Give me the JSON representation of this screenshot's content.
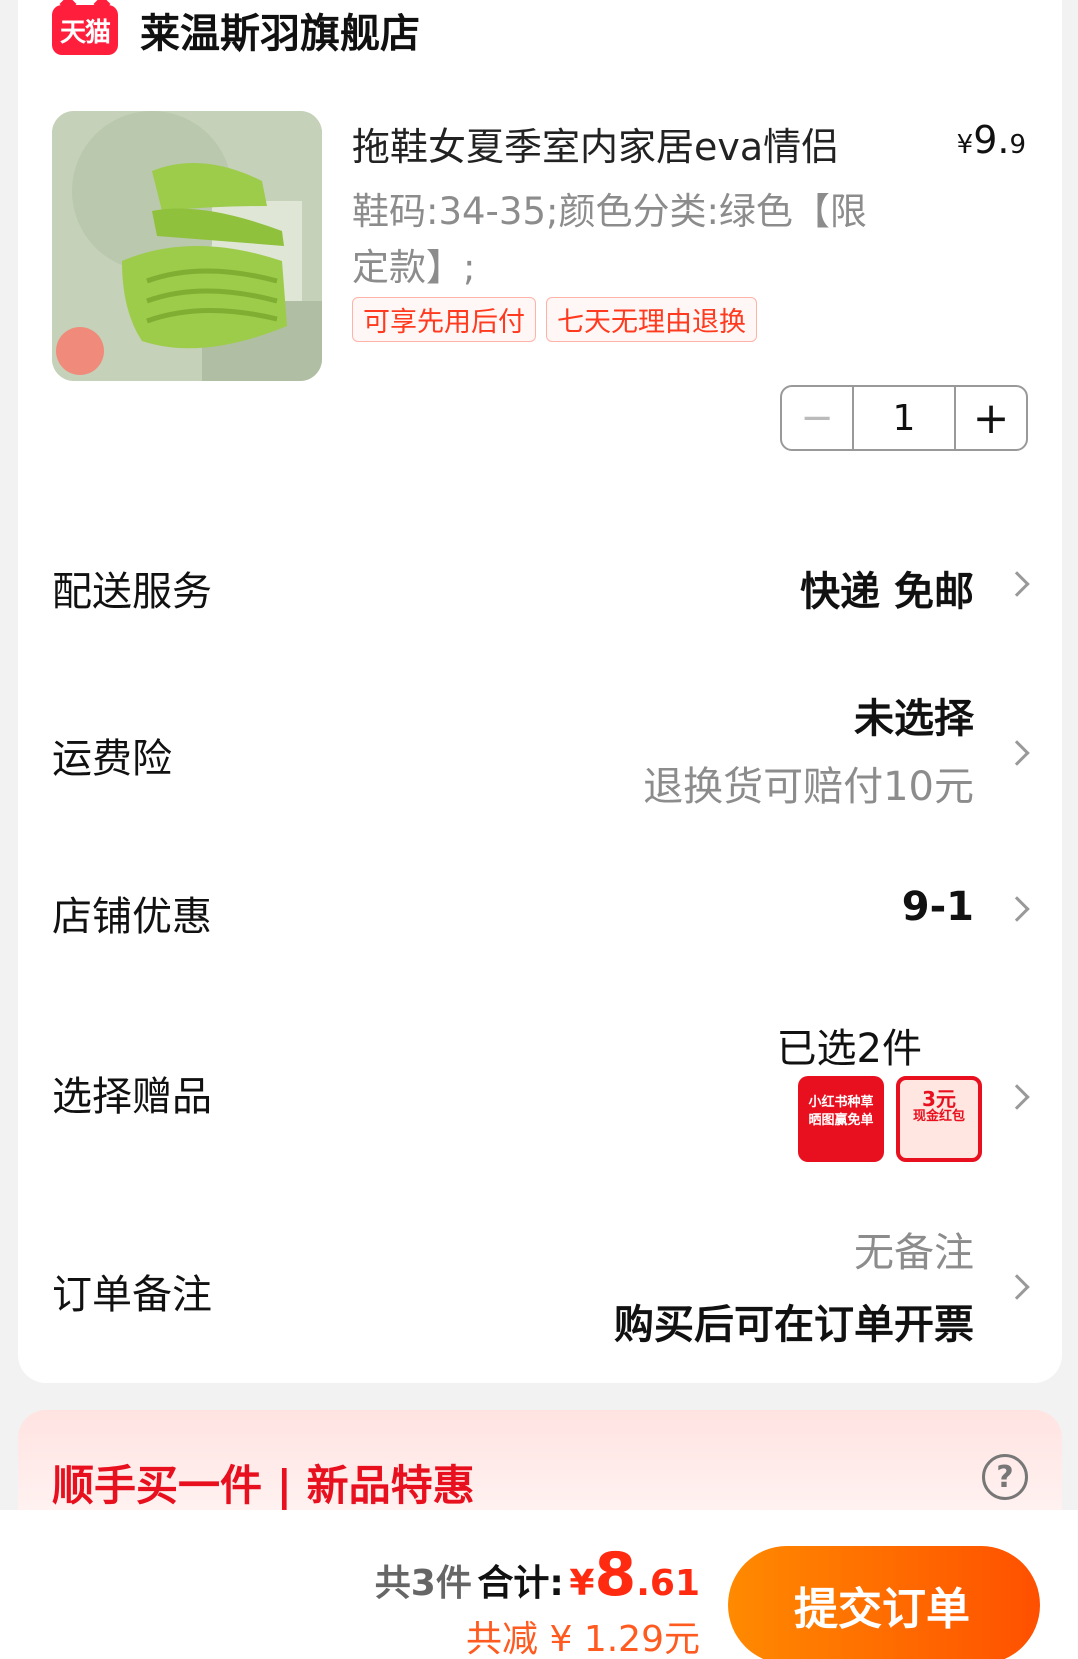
{
  "shop": {
    "badge": "天猫",
    "name": "莱温斯羽旗舰店"
  },
  "product": {
    "title": "拖鞋女夏季室内家居eva情侣",
    "price_currency": "¥",
    "price_int": "9.",
    "price_dec": "9",
    "sku": "鞋码:34-35;颜色分类:绿色【限定款】;",
    "tags": [
      "可享先用后付",
      "七天无理由退换"
    ],
    "quantity": "1",
    "minus": "−",
    "plus": "+"
  },
  "rows": {
    "delivery": {
      "label": "配送服务",
      "value": "快递 免邮"
    },
    "insurance": {
      "label": "运费险",
      "value": "未选择",
      "sub": "退换货可赔付10元"
    },
    "discount": {
      "label": "店铺优惠",
      "value": "9-1"
    },
    "gifts": {
      "label": "选择赠品",
      "value": "已选2件",
      "gift1_line1": "小红书种草",
      "gift1_line2": "晒图赢免单",
      "gift2_line1": "3元",
      "gift2_line2": "现金红包"
    },
    "note": {
      "label": "订单备注",
      "value": "无备注",
      "sub": "购买后可在订单开票"
    }
  },
  "promo": {
    "title": "顺手买一件 | 新品特惠",
    "help": "?"
  },
  "bottom": {
    "count": "共3件",
    "total_label": "合计:",
    "total_currency": "¥",
    "total_int": "8",
    "total_dec": ".61",
    "discount": "共减 ¥ 1.29元",
    "submit": "提交订单"
  },
  "colors": {
    "accent": "#ff2a10",
    "tmall": "#ff1e3c",
    "submit_start": "#ff8a00",
    "submit_end": "#ff5000"
  }
}
